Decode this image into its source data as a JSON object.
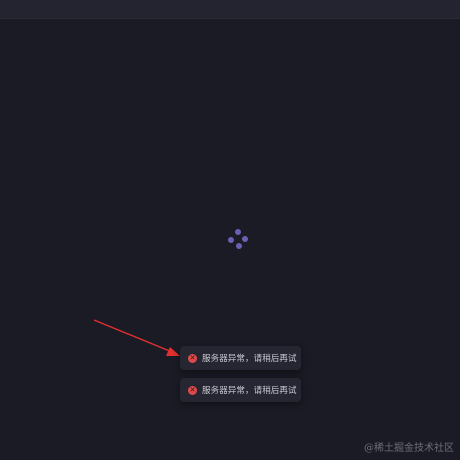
{
  "toasts": [
    {
      "message": "服务器异常，请稍后再试",
      "icon": "error-icon",
      "color": "#e04a4a"
    },
    {
      "message": "服务器异常，请稍后再试",
      "icon": "error-icon",
      "color": "#e04a4a"
    }
  ],
  "loading": {
    "icon": "loading-spinner-icon",
    "color": "#6e5fb6"
  },
  "annotation": {
    "icon": "red-arrow",
    "color": "#e03030"
  },
  "watermark": "@稀土掘金技术社区"
}
